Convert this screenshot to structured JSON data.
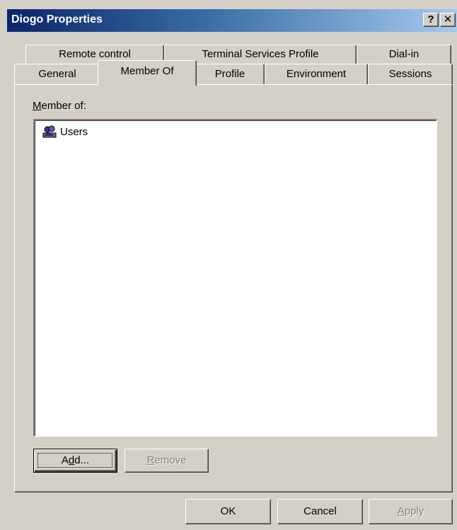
{
  "window": {
    "title": "Diogo Properties",
    "help_label": "?",
    "close_label": "✕"
  },
  "tabs": {
    "row1": [
      {
        "label": "Remote control"
      },
      {
        "label": "Terminal Services Profile"
      },
      {
        "label": "Dial-in"
      }
    ],
    "row2": [
      {
        "label": "General"
      },
      {
        "label": "Member Of",
        "active": true
      },
      {
        "label": "Profile"
      },
      {
        "label": "Environment"
      },
      {
        "label": "Sessions"
      }
    ]
  },
  "member_of": {
    "label_accel": "M",
    "label_rest": "ember of:",
    "items": [
      {
        "name": "Users",
        "icon": "group-icon"
      }
    ]
  },
  "buttons": {
    "add_pre": "A",
    "add_accel": "d",
    "add_post": "d...",
    "remove_accel": "R",
    "remove_rest": "emove",
    "ok": "OK",
    "cancel": "Cancel",
    "apply_accel": "A",
    "apply_rest": "pply"
  }
}
